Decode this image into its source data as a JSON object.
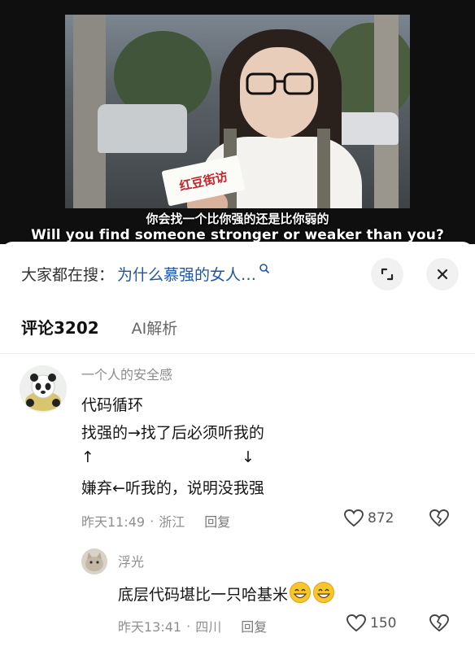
{
  "video": {
    "mic_label": "红豆街访",
    "subtitle_cn": "你会找一个比你强的还是比你弱的",
    "subtitle_en": "Will you find someone stronger or weaker than you?"
  },
  "search": {
    "prefix": "大家都在搜：",
    "query": "为什么慕强的女人…"
  },
  "tabs": {
    "comments": "评论3202",
    "ai": "AI解析"
  },
  "comments": [
    {
      "username": "一个人的安全感",
      "lines": [
        "代码循环",
        "找强的→找了后必须听我的",
        "↑                              ↓",
        "嫌弃←听我的，说明没我强"
      ],
      "time": "昨天11:49",
      "location": "浙江",
      "reply_label": "回复",
      "likes": "872"
    },
    {
      "username": "浮光",
      "text": "底层代码堪比一只哈基米",
      "time": "昨天13:41",
      "location": "四川",
      "reply_label": "回复",
      "likes": "150"
    }
  ]
}
